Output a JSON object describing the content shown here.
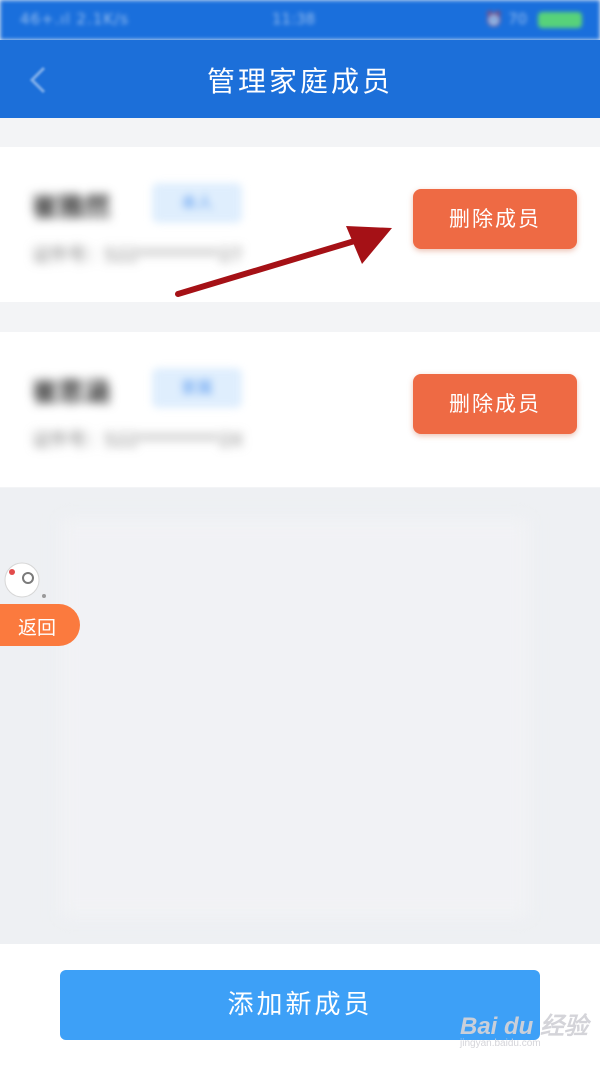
{
  "status_bar": {
    "left": "46+.ıl 2.1K/s",
    "center": "11:38",
    "right": "⏰ 70"
  },
  "nav": {
    "title": "管理家庭成员",
    "back_icon": "chevron-left-icon"
  },
  "members": [
    {
      "name": "崔雅然",
      "tag": "本人",
      "id_text": "证件号：522*********27",
      "delete_label": "删除成员"
    },
    {
      "name": "崔思涵",
      "tag": "家属",
      "id_text": "证件号：522*********2X",
      "delete_label": "删除成员"
    }
  ],
  "float_button": {
    "label": "返回"
  },
  "footer": {
    "add_label": "添加新成员"
  },
  "watermark": {
    "text": "Bai du 经验",
    "sub": "jingyan.baidu.com"
  },
  "colors": {
    "nav_blue": "#1c6fd9",
    "delete_orange": "#ee6a44",
    "add_blue": "#3da0f7",
    "annotation_red": "#a51116"
  }
}
